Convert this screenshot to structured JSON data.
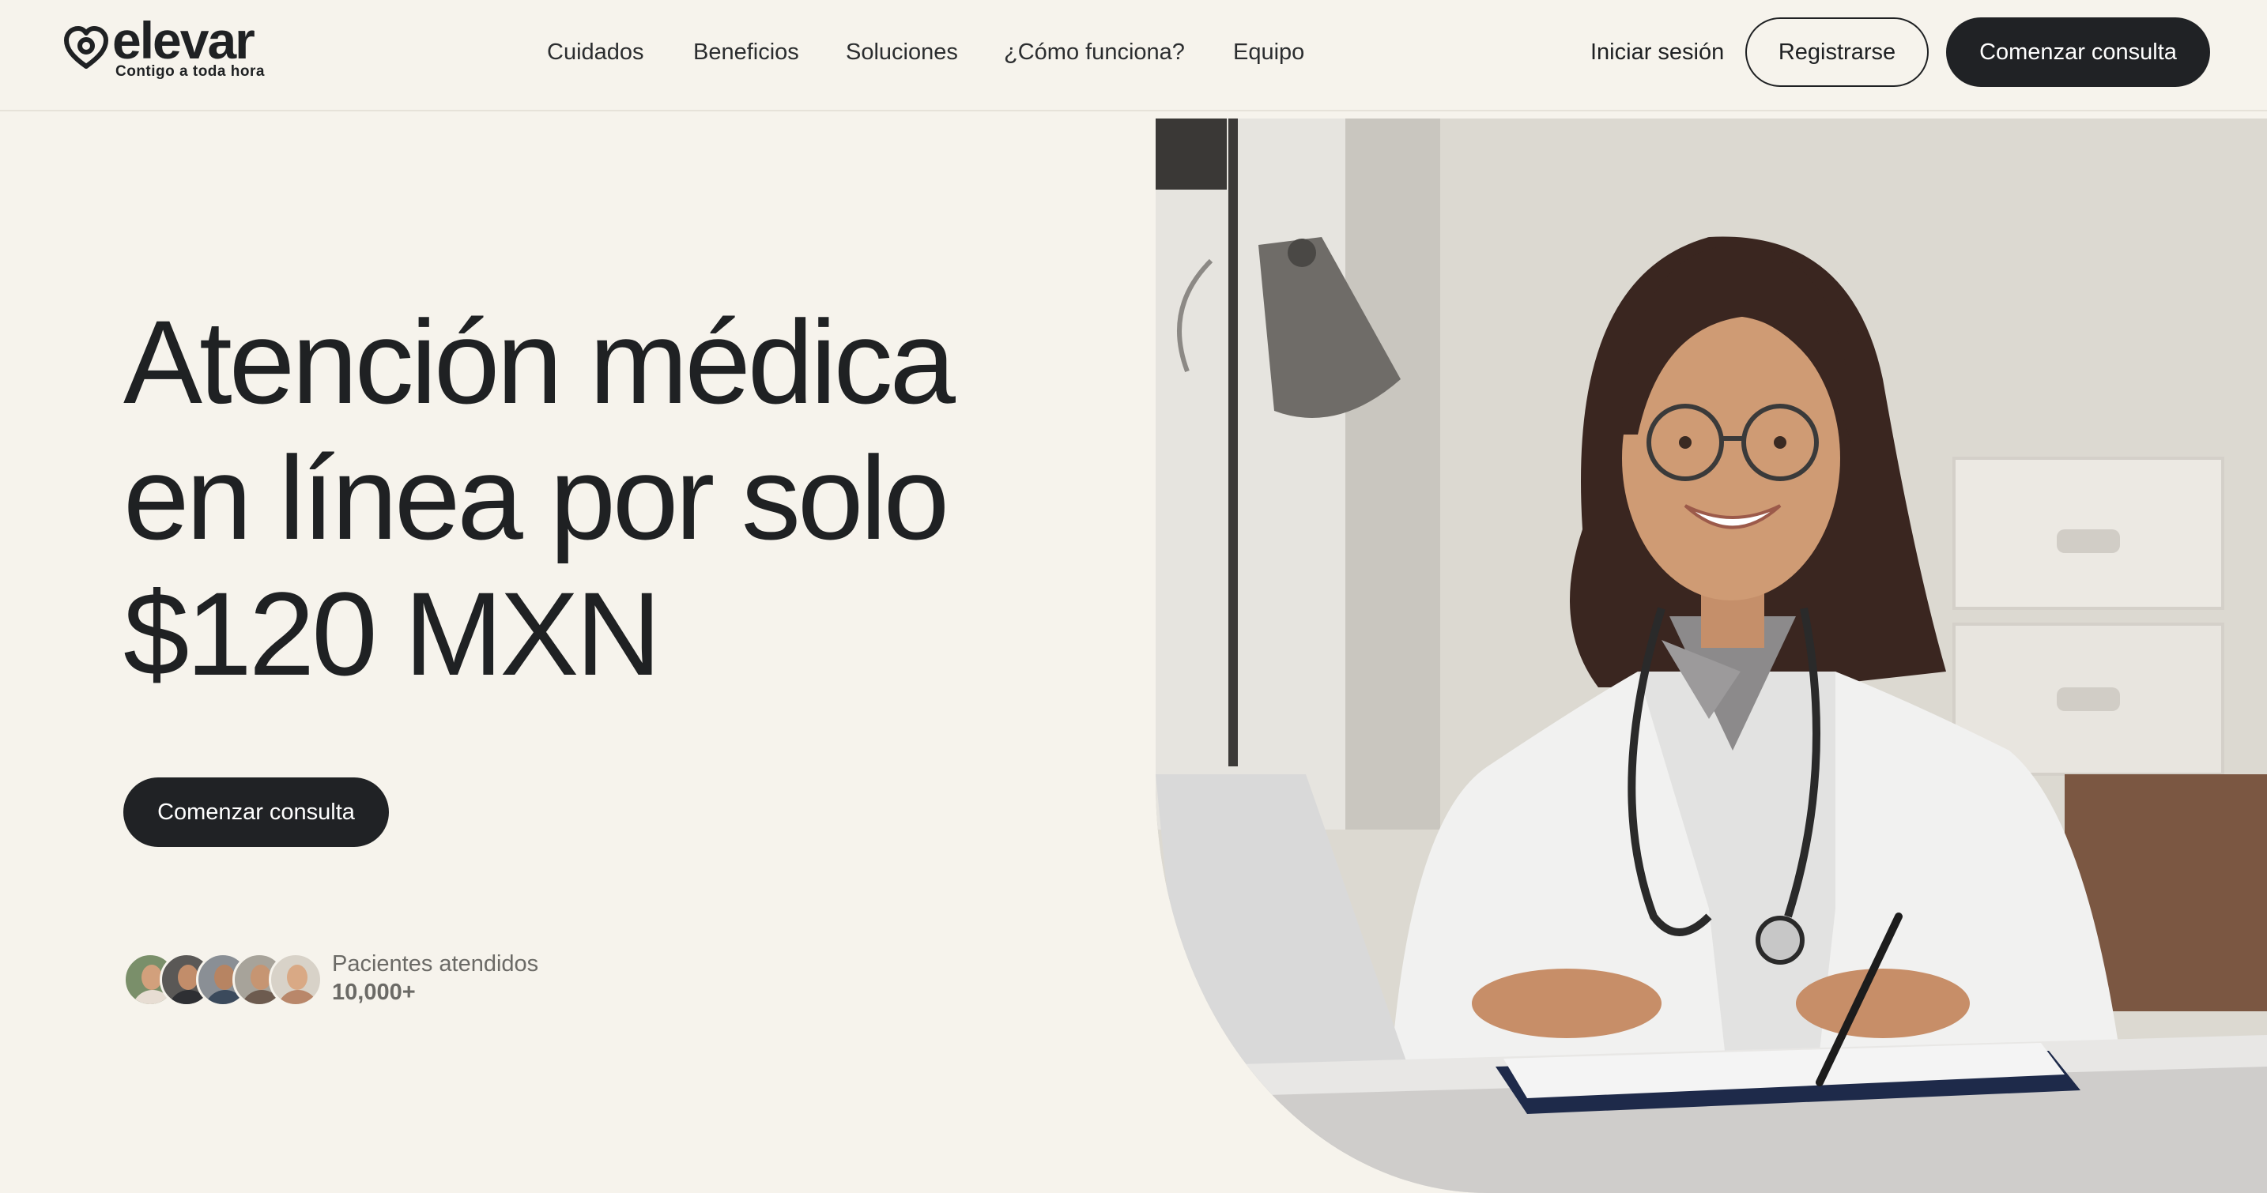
{
  "brand": {
    "name": "elevar",
    "tagline": "Contigo a toda hora"
  },
  "nav": {
    "items": [
      {
        "label": "Cuidados"
      },
      {
        "label": "Beneficios"
      },
      {
        "label": "Soluciones"
      },
      {
        "label": "¿Cómo funciona?"
      },
      {
        "label": "Equipo"
      }
    ],
    "login_label": "Iniciar sesión",
    "register_label": "Registrarse",
    "cta_label": "Comenzar consulta"
  },
  "hero": {
    "title_lines": [
      "Atención médica",
      "en línea por solo",
      "$120 MXN"
    ],
    "cta_label": "Comenzar consulta",
    "stat_label": "Pacientes atendidos",
    "stat_value": "10,000+",
    "avatar_count": 5
  },
  "colors": {
    "background": "#f6f3ec",
    "text": "#1f2123",
    "button_dark": "#202225",
    "muted_text": "#6b6a66"
  },
  "icons": {
    "logo": "heart-logo-icon"
  }
}
